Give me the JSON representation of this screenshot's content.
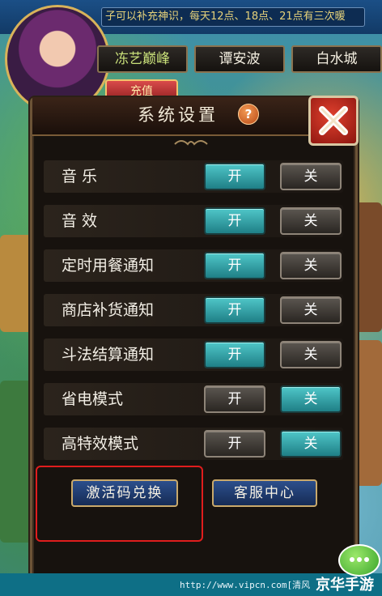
{
  "hud": {
    "marquee": "子可以补充神识，每天12点、18点、21点有三次暖",
    "tabs": [
      "冻艺巅峰",
      "谭安波",
      "白水城"
    ],
    "recharge_label": "充值"
  },
  "dialog": {
    "title": "系统设置",
    "help_glyph": "?",
    "settings": [
      {
        "label": "音  乐",
        "on_label": "开",
        "off_label": "关",
        "value": "on"
      },
      {
        "label": "音  效",
        "on_label": "开",
        "off_label": "关",
        "value": "on"
      },
      {
        "label": "定时用餐通知",
        "on_label": "开",
        "off_label": "关",
        "value": "on"
      },
      {
        "label": "商店补货通知",
        "on_label": "开",
        "off_label": "关",
        "value": "on"
      },
      {
        "label": "斗法结算通知",
        "on_label": "开",
        "off_label": "关",
        "value": "on"
      },
      {
        "label": "省电模式",
        "on_label": "开",
        "off_label": "关",
        "value": "off"
      },
      {
        "label": "高特效模式",
        "on_label": "开",
        "off_label": "关",
        "value": "off"
      }
    ],
    "redeem_label": "激活码兑换",
    "service_label": "客服中心"
  },
  "watermark": {
    "url": "http://www.vipcn.com[清风",
    "brand": "京华手游"
  },
  "colors": {
    "toggle_on": "#2aa3a8",
    "toggle_off": "#4a4540",
    "highlight": "#e01d1d",
    "close": "#c42a1c"
  }
}
